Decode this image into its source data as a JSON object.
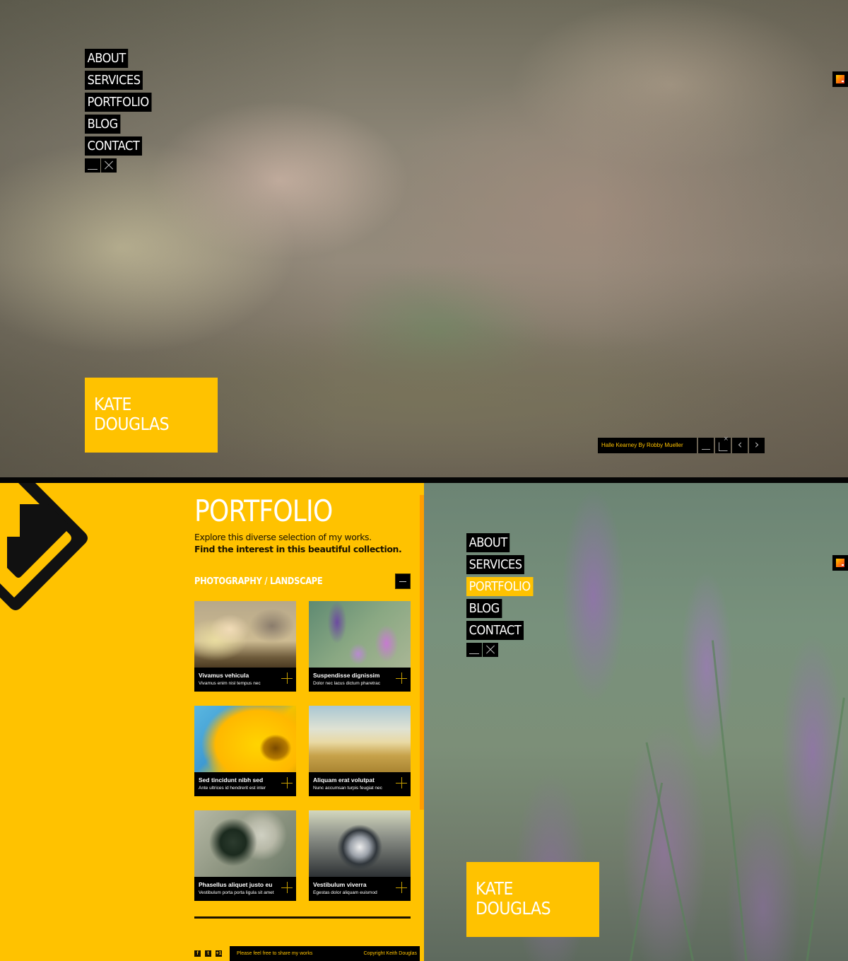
{
  "brand": {
    "accent": "#ffc200",
    "scrollbar": "#ff9d00",
    "dark": "#000000"
  },
  "screen1": {
    "nav": {
      "items": [
        {
          "label": "ABOUT",
          "active": false
        },
        {
          "label": "SERVICES",
          "active": false
        },
        {
          "label": "PORTFOLIO",
          "active": false
        },
        {
          "label": "BLOG",
          "active": false
        },
        {
          "label": "CONTACT",
          "active": false
        }
      ],
      "controls": [
        {
          "icon": "minimize-icon"
        },
        {
          "icon": "close-icon"
        }
      ]
    },
    "corner_widget": {
      "icon": "color-palette-icon"
    },
    "name_card": {
      "line1": "KATE",
      "line2": "DOUGLAS"
    },
    "caption": {
      "text": "Halle Kearney By Robby Mueller",
      "buttons": [
        {
          "icon": "minimize-icon"
        },
        {
          "icon": "fullscreen-icon"
        },
        {
          "icon": "chevron-left-icon",
          "glyph": "‹"
        },
        {
          "icon": "chevron-right-icon",
          "glyph": "›"
        }
      ]
    }
  },
  "screen2": {
    "portfolio": {
      "title": "PORTFOLIO",
      "intro_line1": "Explore this diverse selection of my works.",
      "intro_line2": "Find the interest in this beautiful collection.",
      "category": "PHOTOGRAPHY / LANDSCAPE",
      "items": [
        {
          "title": "Vivamus vehicula",
          "subtitle": "Vivamus enim nisl tempus nec"
        },
        {
          "title": "Suspendisse dignissim",
          "subtitle": "Dolor nec lacus dictum pharetrac"
        },
        {
          "title": "Sed tincidunt nibh sed",
          "subtitle": "Ante ultrices id hendrerit est inter"
        },
        {
          "title": "Aliquam erat volutpat",
          "subtitle": "Nunc accumsan turpis feugiat nec"
        },
        {
          "title": "Phasellus aliquet justo eu",
          "subtitle": "Vestibulum porta porta ligula sit amet"
        },
        {
          "title": "Vestibulum viverra",
          "subtitle": "Egestas dolor aliquam euismod"
        }
      ],
      "social": [
        {
          "icon": "facebook-icon",
          "glyph": "f"
        },
        {
          "icon": "twitter-icon",
          "glyph": "t"
        },
        {
          "icon": "google-plus-icon",
          "glyph": "+1"
        }
      ],
      "footer_left": "Please feel free to share my works",
      "footer_right": "Copyright Keith Douglas"
    },
    "nav": {
      "items": [
        {
          "label": "ABOUT",
          "active": false
        },
        {
          "label": "SERVICES",
          "active": false
        },
        {
          "label": "PORTFOLIO",
          "active": true
        },
        {
          "label": "BLOG",
          "active": false
        },
        {
          "label": "CONTACT",
          "active": false
        }
      ]
    },
    "name_card": {
      "line1": "KATE",
      "line2": "DOUGLAS"
    }
  }
}
